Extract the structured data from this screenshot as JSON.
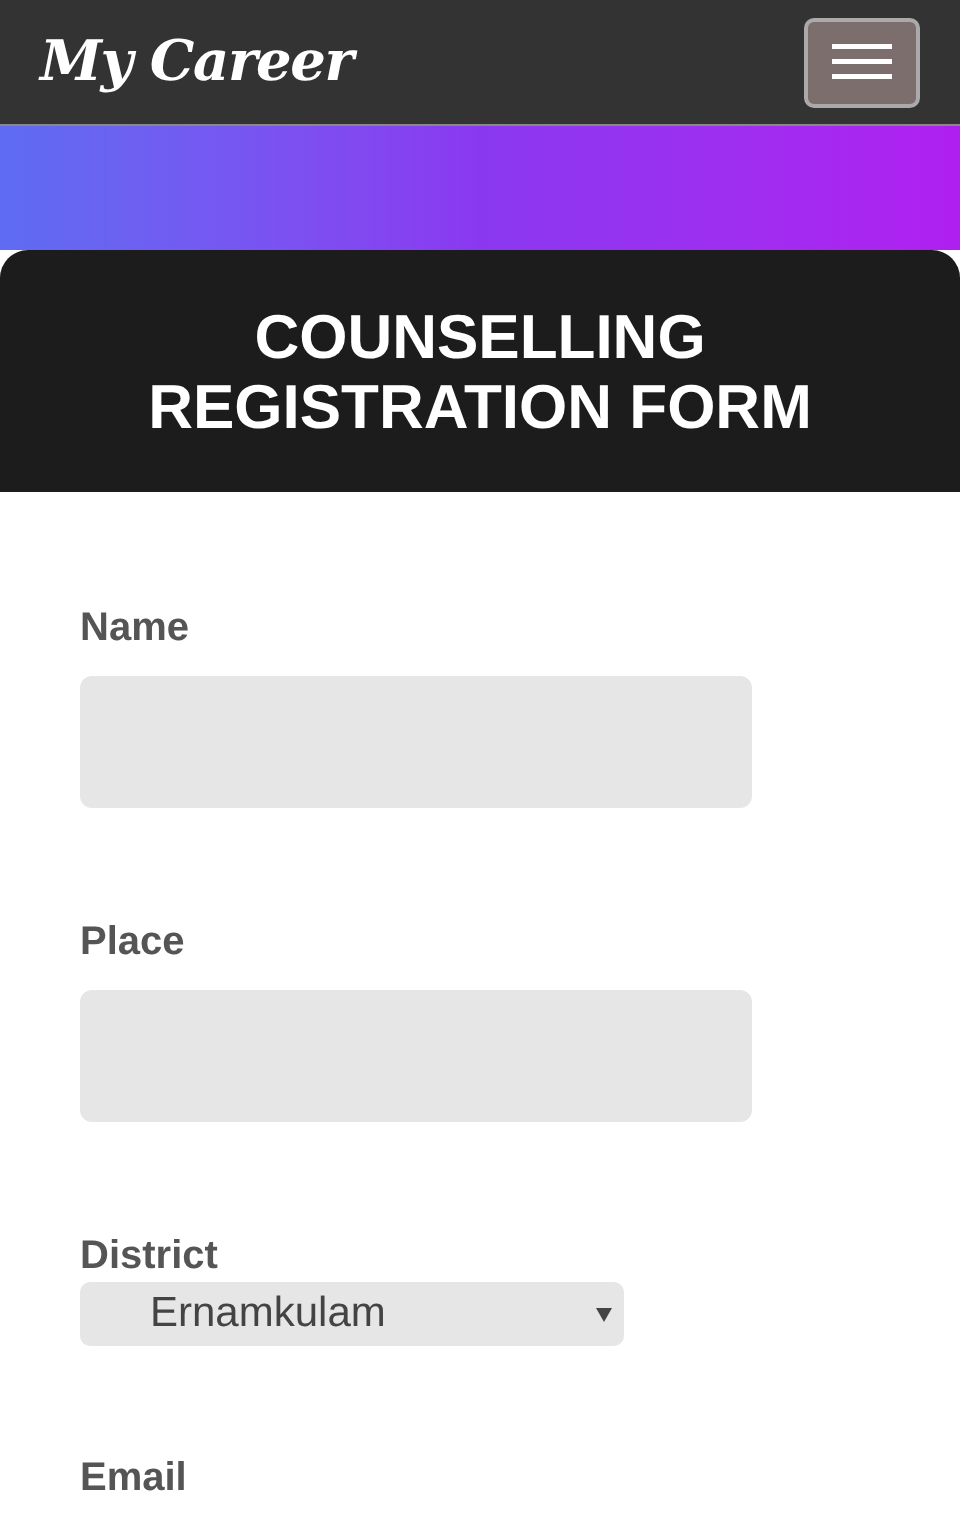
{
  "navbar": {
    "brand": "My Career"
  },
  "banner": {
    "title": "COUNSELLING REGISTRATION FORM"
  },
  "form": {
    "fields": [
      {
        "kind": "text",
        "label": "Name"
      },
      {
        "kind": "text",
        "label": "Place"
      },
      {
        "kind": "select",
        "label": "District",
        "value": "Ernamkulam"
      },
      {
        "kind": "label",
        "label": "Email"
      }
    ]
  }
}
